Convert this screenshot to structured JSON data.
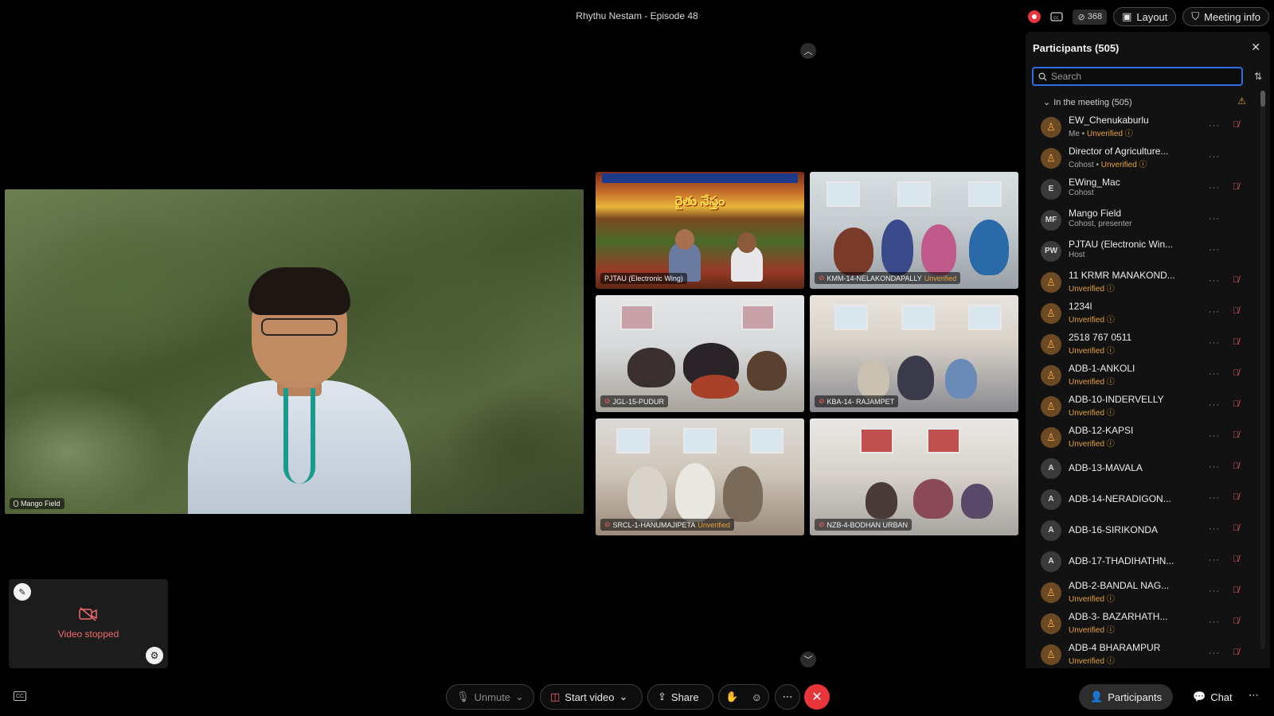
{
  "meeting": {
    "title": "Rhythu Nestam - Episode 48",
    "viewer_count": "368",
    "layout_label": "Layout",
    "meeting_info_label": "Meeting info"
  },
  "main_video": {
    "name": "Mango Field"
  },
  "tiles": [
    {
      "name": "PJTAU (Electronic Wing)",
      "unverified": "",
      "banner_text": "రైతు నేస్తం"
    },
    {
      "name": "KMM-14-NELAKONDAPALLY",
      "unverified": "Unverified"
    },
    {
      "name": "JGL-15-PUDUR",
      "unverified": ""
    },
    {
      "name": "KBA-14- RAJAMPET",
      "unverified": ""
    },
    {
      "name": "SRCL-1-HANUMAJIPETA",
      "unverified": "Unverified"
    },
    {
      "name": "NZB-4-BODHAN URBAN",
      "unverified": ""
    }
  ],
  "self_view": {
    "status": "Video stopped"
  },
  "toolbar": {
    "unmute": "Unmute",
    "start_video": "Start video",
    "share": "Share",
    "participants": "Participants",
    "chat": "Chat"
  },
  "panel": {
    "title": "Participants (505)",
    "search_placeholder": "Search",
    "section": "In the meeting (505)"
  },
  "participants": [
    {
      "initials": "",
      "name": "EW_Chenukaburlu",
      "role": "Me",
      "unverified": "Unverified",
      "avatar": "orange",
      "muted": true
    },
    {
      "initials": "",
      "name": "Director of Agriculture...",
      "role": "Cohost",
      "unverified": "Unverified",
      "avatar": "orange",
      "muted": false
    },
    {
      "initials": "E",
      "name": "EWing_Mac",
      "role": "Cohost",
      "unverified": "",
      "avatar": "gray",
      "muted": true
    },
    {
      "initials": "MF",
      "name": "Mango Field",
      "role": "Cohost, presenter",
      "unverified": "",
      "avatar": "gray",
      "muted": false
    },
    {
      "initials": "PW",
      "name": "PJTAU (Electronic Win...",
      "role": "Host",
      "unverified": "",
      "avatar": "gray",
      "muted": false
    },
    {
      "initials": "",
      "name": "11 KRMR MANAKOND...",
      "role": "",
      "unverified": "Unverified",
      "avatar": "orange",
      "muted": true
    },
    {
      "initials": "",
      "name": "1234l",
      "role": "",
      "unverified": "Unverified",
      "avatar": "orange",
      "muted": true
    },
    {
      "initials": "",
      "name": "2518 767 0511",
      "role": "",
      "unverified": "Unverified",
      "avatar": "orange",
      "muted": true
    },
    {
      "initials": "",
      "name": "ADB-1-ANKOLI",
      "role": "",
      "unverified": "Unverified",
      "avatar": "orange",
      "muted": true
    },
    {
      "initials": "",
      "name": "ADB-10-INDERVELLY",
      "role": "",
      "unverified": "Unverified",
      "avatar": "orange",
      "muted": true
    },
    {
      "initials": "",
      "name": "ADB-12-KAPSI",
      "role": "",
      "unverified": "Unverified",
      "avatar": "orange",
      "muted": true
    },
    {
      "initials": "A",
      "name": "ADB-13-MAVALA",
      "role": "",
      "unverified": "",
      "avatar": "gray",
      "muted": true
    },
    {
      "initials": "A",
      "name": "ADB-14-NERADIGON...",
      "role": "",
      "unverified": "",
      "avatar": "gray",
      "muted": true
    },
    {
      "initials": "A",
      "name": "ADB-16-SIRIKONDA",
      "role": "",
      "unverified": "",
      "avatar": "gray",
      "muted": true
    },
    {
      "initials": "A",
      "name": "ADB-17-THADIHATHN...",
      "role": "",
      "unverified": "",
      "avatar": "gray",
      "muted": true
    },
    {
      "initials": "",
      "name": "ADB-2-BANDAL NAG...",
      "role": "",
      "unverified": "Unverified",
      "avatar": "orange",
      "muted": true
    },
    {
      "initials": "",
      "name": "ADB-3- BAZARHATH...",
      "role": "",
      "unverified": "Unverified",
      "avatar": "orange",
      "muted": true
    },
    {
      "initials": "",
      "name": "ADB-4 BHARAMPUR",
      "role": "",
      "unverified": "Unverified",
      "avatar": "orange",
      "muted": true
    }
  ],
  "colors": {
    "accent": "#2f6fe6",
    "record": "#e8343b",
    "warning": "#e6a23c"
  }
}
